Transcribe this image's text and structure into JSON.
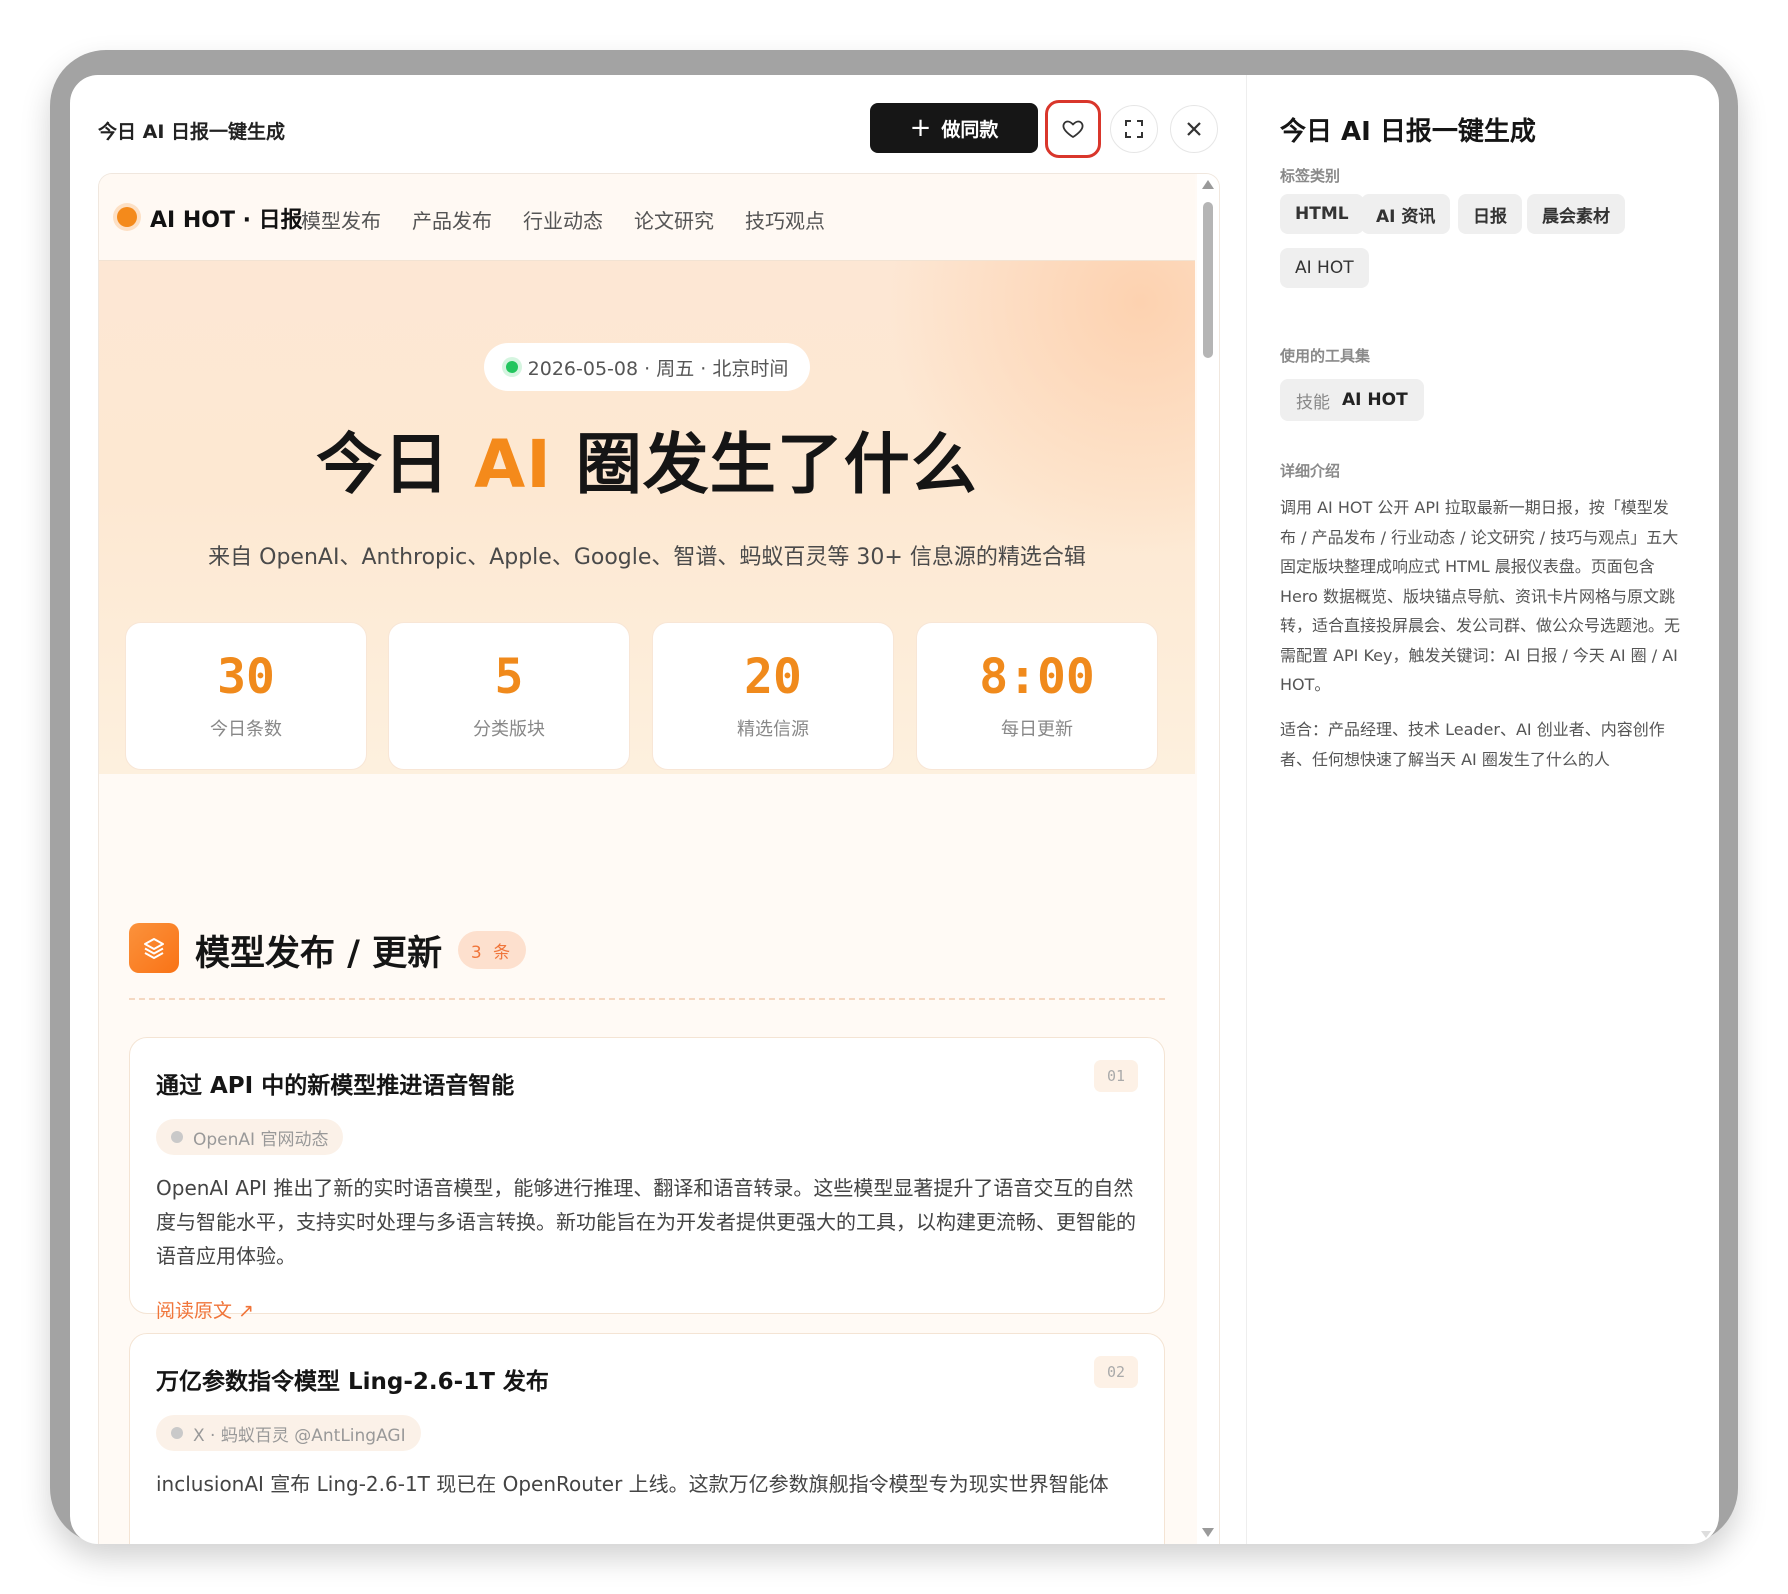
{
  "window": {
    "title": "今日 AI 日报一键生成"
  },
  "toolbar": {
    "make_label": "做同款",
    "make_plus": "+"
  },
  "preview": {
    "nav": {
      "brand": "AI HOT · 日报",
      "links": [
        "模型发布",
        "产品发布",
        "行业动态",
        "论文研究",
        "技巧观点"
      ]
    },
    "hero": {
      "date": "2026-05-08 · 周五 · 北京时间",
      "title_pre": "今日 ",
      "title_ai": "AI",
      "title_post": " 圈发生了什么",
      "subtitle": "来自 OpenAI、Anthropic、Apple、Google、智谱、蚂蚁百灵等 30+ 信息源的精选合辑",
      "stats": [
        {
          "value": "30",
          "label": "今日条数"
        },
        {
          "value": "5",
          "label": "分类版块"
        },
        {
          "value": "20",
          "label": "精选信源"
        },
        {
          "value": "8:00",
          "label": "每日更新"
        }
      ]
    },
    "section": {
      "title": "模型发布 / 更新",
      "count": "3 条"
    },
    "cards": [
      {
        "num": "01",
        "title": "通过 API 中的新模型推进语音智能",
        "source": "OpenAI 官网动态",
        "body": "OpenAI API 推出了新的实时语音模型，能够进行推理、翻译和语音转录。这些模型显著提升了语音交互的自然度与智能水平，支持实时处理与多语言转换。新功能旨在为开发者提供更强大的工具，以构建更流畅、更智能的语音应用体验。",
        "link": "阅读原文 ↗"
      },
      {
        "num": "02",
        "title": "万亿参数指令模型 Ling-2.6-1T 发布",
        "source": "X · 蚂蚁百灵 @AntLingAGI",
        "body": "inclusionAI 宣布 Ling-2.6-1T 现已在 OpenRouter 上线。这款万亿参数旗舰指令模型专为现实世界智能体"
      }
    ]
  },
  "info": {
    "title": "今日 AI 日报一键生成",
    "tags_label": "标签类别",
    "tags": [
      "HTML",
      "AI 资讯",
      "日报",
      "晨会素材",
      "AI HOT"
    ],
    "tools_label": "使用的工具集",
    "tool": {
      "kind": "技能",
      "name": "AI HOT"
    },
    "detail_label": "详细介绍",
    "detail": "调用 AI HOT 公开 API 拉取最新一期日报，按「模型发布 / 产品发布 / 行业动态 / 论文研究 / 技巧与观点」五大固定版块整理成响应式 HTML 晨报仪表盘。页面包含 Hero 数据概览、版块锚点导航、资讯卡片网格与原文跳转，适合直接投屏晨会、发公司群、做公众号选题池。无需配置 API Key，触发关键词：AI 日报 / 今天 AI 圈 / AI HOT。",
    "audience": "适合：产品经理、技术 Leader、AI 创业者、内容创作者、任何想快速了解当天 AI 圈发生了什么的人"
  },
  "colors": {
    "accent": "#f48a1b",
    "favorite_outline": "#d9362b",
    "primary_button": "#161616"
  }
}
